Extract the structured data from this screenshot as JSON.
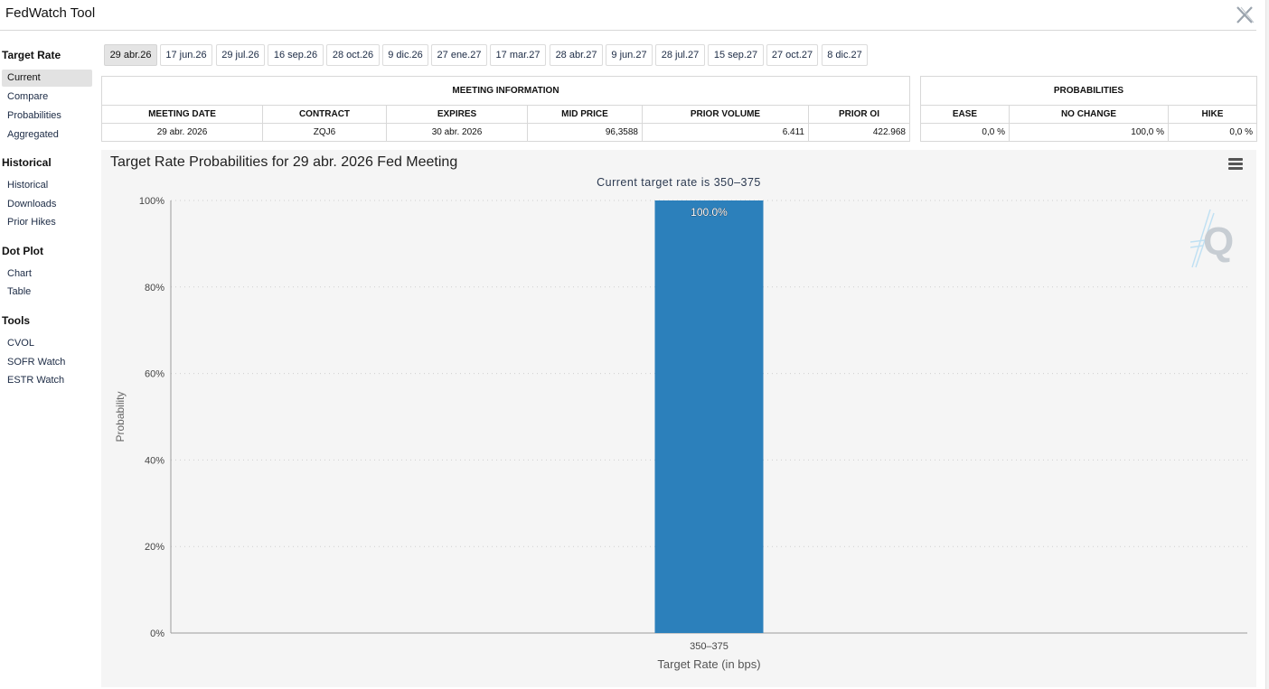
{
  "app_title": "FedWatch Tool",
  "sidebar": {
    "target_rate": {
      "heading": "Target Rate",
      "items": [
        "Current",
        "Compare",
        "Probabilities",
        "Aggregated"
      ]
    },
    "historical": {
      "heading": "Historical",
      "items": [
        "Historical",
        "Downloads",
        "Prior Hikes"
      ]
    },
    "dot_plot": {
      "heading": "Dot Plot",
      "items": [
        "Chart",
        "Table"
      ]
    },
    "tools": {
      "heading": "Tools",
      "items": [
        "CVOL",
        "SOFR Watch",
        "ESTR Watch"
      ]
    }
  },
  "tabs": [
    "29 abr.26",
    "17 jun.26",
    "29 jul.26",
    "16 sep.26",
    "28 oct.26",
    "9 dic.26",
    "27 ene.27",
    "17 mar.27",
    "28 abr.27",
    "9 jun.27",
    "28 jul.27",
    "15 sep.27",
    "27 oct.27",
    "8 dic.27"
  ],
  "meeting_info": {
    "heading": "MEETING INFORMATION",
    "columns": [
      "MEETING DATE",
      "CONTRACT",
      "EXPIRES",
      "MID PRICE",
      "PRIOR VOLUME",
      "PRIOR OI"
    ],
    "row": [
      "29 abr. 2026",
      "ZQJ6",
      "30 abr. 2026",
      "96,3588",
      "6.411",
      "422.968"
    ]
  },
  "probabilities": {
    "heading": "PROBABILITIES",
    "columns": [
      "EASE",
      "NO CHANGE",
      "HIKE"
    ],
    "row": [
      "0,0 %",
      "100,0 %",
      "0,0 %"
    ]
  },
  "accent_color": "#2c80bb",
  "chart_data": {
    "type": "bar",
    "title": "Target Rate Probabilities for 29 abr. 2026 Fed Meeting",
    "subtitle": "Current target rate is 350–375",
    "xlabel": "Target Rate (in bps)",
    "ylabel": "Probability",
    "categories": [
      "350–375"
    ],
    "values": [
      100.0
    ],
    "data_labels": [
      "100.0%"
    ],
    "yticks": [
      "0%",
      "20%",
      "40%",
      "60%",
      "80%",
      "100%"
    ],
    "ylim": [
      0,
      100
    ],
    "grid": true,
    "legend": false
  }
}
